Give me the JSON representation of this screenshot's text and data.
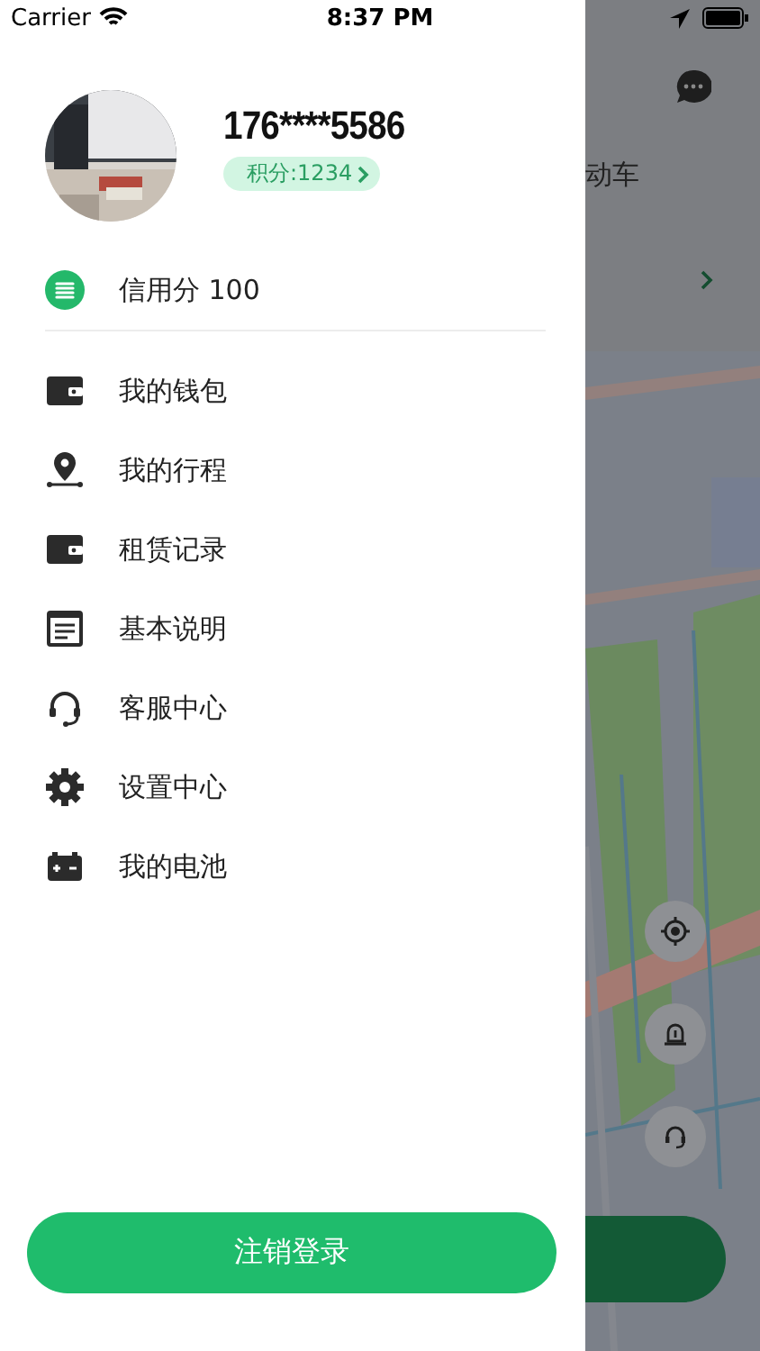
{
  "status_bar": {
    "carrier": "Carrier",
    "time": "8:37 PM"
  },
  "profile": {
    "phone": "176****5586",
    "points": "积分:1234"
  },
  "credit": {
    "label": "信用分 100"
  },
  "menu": [
    {
      "kind": "wallet",
      "label": "我的钱包"
    },
    {
      "kind": "route",
      "label": "我的行程"
    },
    {
      "kind": "wallet",
      "label": "租赁记录"
    },
    {
      "kind": "document",
      "label": "基本说明"
    },
    {
      "kind": "headset",
      "label": "客服中心"
    },
    {
      "kind": "gear",
      "label": "设置中心"
    },
    {
      "kind": "battery",
      "label": "我的电池"
    }
  ],
  "logout": {
    "label": "注销登录"
  },
  "background": {
    "title_fragment": "动车"
  }
}
